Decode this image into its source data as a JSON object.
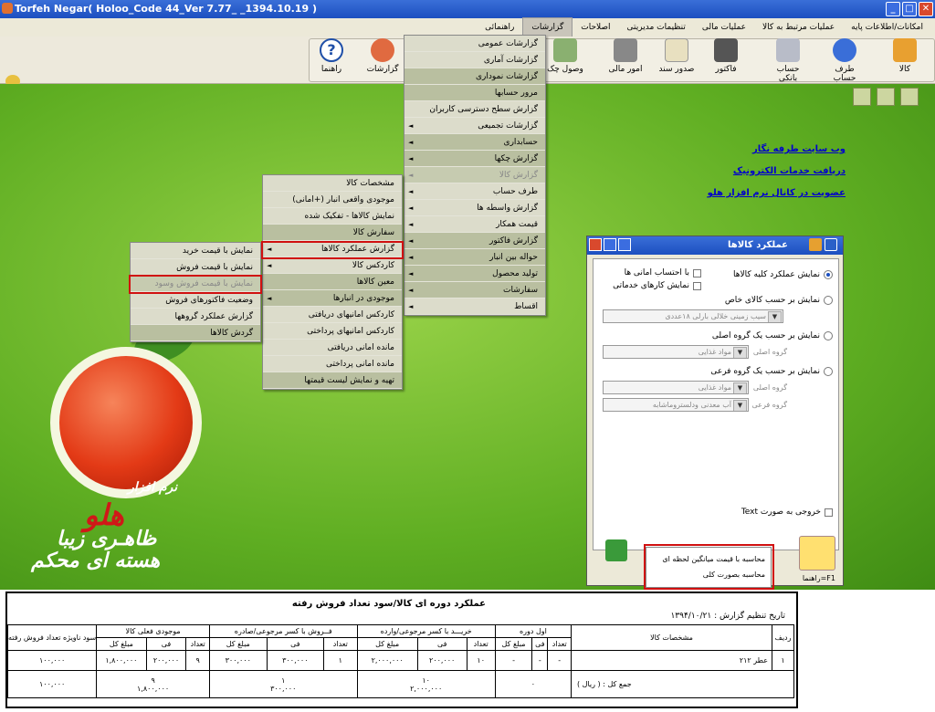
{
  "window": {
    "title": "Torfeh Negar( Holoo_Code 44_Ver 7.77_ _1394.10.19 )"
  },
  "menubar": [
    "امکانات/اطلاعات پایه",
    "عملیات مرتبط به کالا",
    "عملیات مالی",
    "تنظیمات مدیریتی",
    "اصلاحات",
    "گزارشات",
    "راهنمائی"
  ],
  "toolbar": {
    "items": [
      "کالا",
      "طرف حساب",
      "حساب بانکی",
      "فاکتور",
      "صدور سند",
      "امور مالی",
      "وصول چک",
      "گزارشات",
      "راهنما"
    ]
  },
  "links": [
    "وب سایت طرفه نگار",
    "دریافت خدمات الکترونیک",
    "عضویت در کانال نرم افزار هلو"
  ],
  "branding": {
    "line1": "نرم افزار",
    "line2": "هلو",
    "line3": "ظاهـری زیبا",
    "line4": "هسته ای محکم"
  },
  "menu_reports": [
    "گزارشات عمومی",
    "گزارشات آماری",
    "گزارشات نموداری",
    "مرور حسابها",
    "گزارش سطح دسترسی کاربران",
    "گزارشات تجمیعی",
    "حسابداری",
    "گزارش چکها",
    "گزارش کالا",
    "طرف حساب",
    "گزارش واسطه ها",
    "قیمت همکار",
    "گزارش فاکتور",
    "حواله بین انبار",
    "تولید محصول",
    "سفارشات",
    "اقساط"
  ],
  "menu_goods": [
    "مشخصات کالا",
    "موجودی واقعی انبار (+امانی)",
    "نمایش کالاها - تفکیک شده",
    "سفارش کالا",
    "گزارش عملکرد کالاها",
    "کاردکس کالا",
    "معین کالاها",
    "موجودی در انبارها",
    "کاردکس امانیهای دریافتی",
    "کاردکس امانیهای پرداختی",
    "مانده امانی دریافتی",
    "مانده امانی پرداختی",
    "تهیه و نمایش لیست قیمتها"
  ],
  "menu_perf": [
    "نمایش با قیمت خرید",
    "نمایش با قیمت فروش",
    "نمایش با قیمت فروش وسود",
    "وضعیت فاکتورهای فروش",
    "گزارش عملکرد گروهها",
    "گردش کالاها"
  ],
  "dialog": {
    "title": "عملکرد کالاها",
    "opt_all": "نمایش عملکرد کلیه کالاها",
    "chk_trust": "با احتساب امانی ها",
    "chk_service": "نمایش کارهای خدماتی",
    "opt_item": "نمایش بر حسب کالای خاص",
    "item_value": "سیب زمینی خلالی بارلی ۱۸عددی",
    "opt_main": "نمایش بر حسب یک گروه اصلی",
    "main_label": "گروه اصلی",
    "main_value": "مواد غذایی",
    "opt_sub": "نمایش بر حسب یک گروه فرعی",
    "sub_main_label": "گروه اصلی",
    "sub_main_value": "مواد غذایی",
    "sub_label": "گروه فرعی",
    "sub_value": "آب معدنی ودلستروماشابه",
    "text_out": "خروجی به صورت Text",
    "help": "راهنما=F1",
    "popup": [
      "محاسبه با قیمت میانگین لحظه ای",
      "محاسبه بصورت کلی"
    ]
  },
  "report": {
    "title": "عملکرد دوره ای کالا/سود تعداد فروش رفته",
    "date_label": "تاریخ تنظیم گزارش :",
    "date": "۱۳۹۴/۱۰/۲۱",
    "headers": {
      "row": "ردیف",
      "spec": "مشخصات کالا",
      "initial": "اول دوره",
      "purchase": "خریـــد با کسر مرجوعی/وارده",
      "sales": "فــروش با کسر مرجوعی/صادره",
      "stock": "موجودی فعلی کالا",
      "profit": "سود ناویژه تعداد فروش رفته"
    },
    "sub": [
      "تعداد",
      "فی",
      "مبلغ کل"
    ],
    "row": {
      "no": "۱",
      "name": "عطر ۲۱۲",
      "init_q": "-",
      "init_f": "-",
      "init_t": "-",
      "pur_q": "۱۰",
      "pur_f": "۲۰۰,۰۰۰",
      "pur_t": "۲,۰۰۰,۰۰۰",
      "sal_q": "۱",
      "sal_f": "۳۰۰,۰۰۰",
      "sal_t": "۳۰۰,۰۰۰",
      "stk_q": "۹",
      "stk_f": "۲۰۰,۰۰۰",
      "stk_t": "۱,۸۰۰,۰۰۰",
      "profit": "۱۰۰,۰۰۰"
    },
    "total": {
      "label": "جمع کل : ( ریال )",
      "init": "۰",
      "pur_q": "۱۰",
      "pur_t": "۲,۰۰۰,۰۰۰",
      "sal_q": "۱",
      "sal_t": "۳۰۰,۰۰۰",
      "stk_q": "۹",
      "stk_t": "۱,۸۰۰,۰۰۰",
      "profit": "۱۰۰,۰۰۰"
    }
  }
}
